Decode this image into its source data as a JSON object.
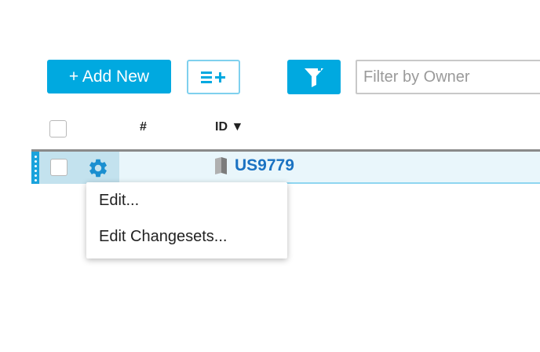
{
  "toolbar": {
    "add_new_label": "+ Add New",
    "multi_add_symbol": "≡+",
    "filter_placeholder": "Filter by Owner",
    "filter_value": ""
  },
  "table": {
    "columns": [
      {
        "key": "rank",
        "label": "#"
      },
      {
        "key": "id",
        "label": "ID ▼"
      }
    ],
    "rows": [
      {
        "id": "US9779",
        "icon": "story-icon",
        "selected": false
      }
    ]
  },
  "context_menu": {
    "items": [
      {
        "label": "Edit..."
      },
      {
        "label": "Edit Changesets..."
      }
    ]
  },
  "colors": {
    "accent": "#00a9e0",
    "link": "#1a72c2",
    "row_bg": "#e9f6fb",
    "row_border": "#8fd6f0"
  }
}
